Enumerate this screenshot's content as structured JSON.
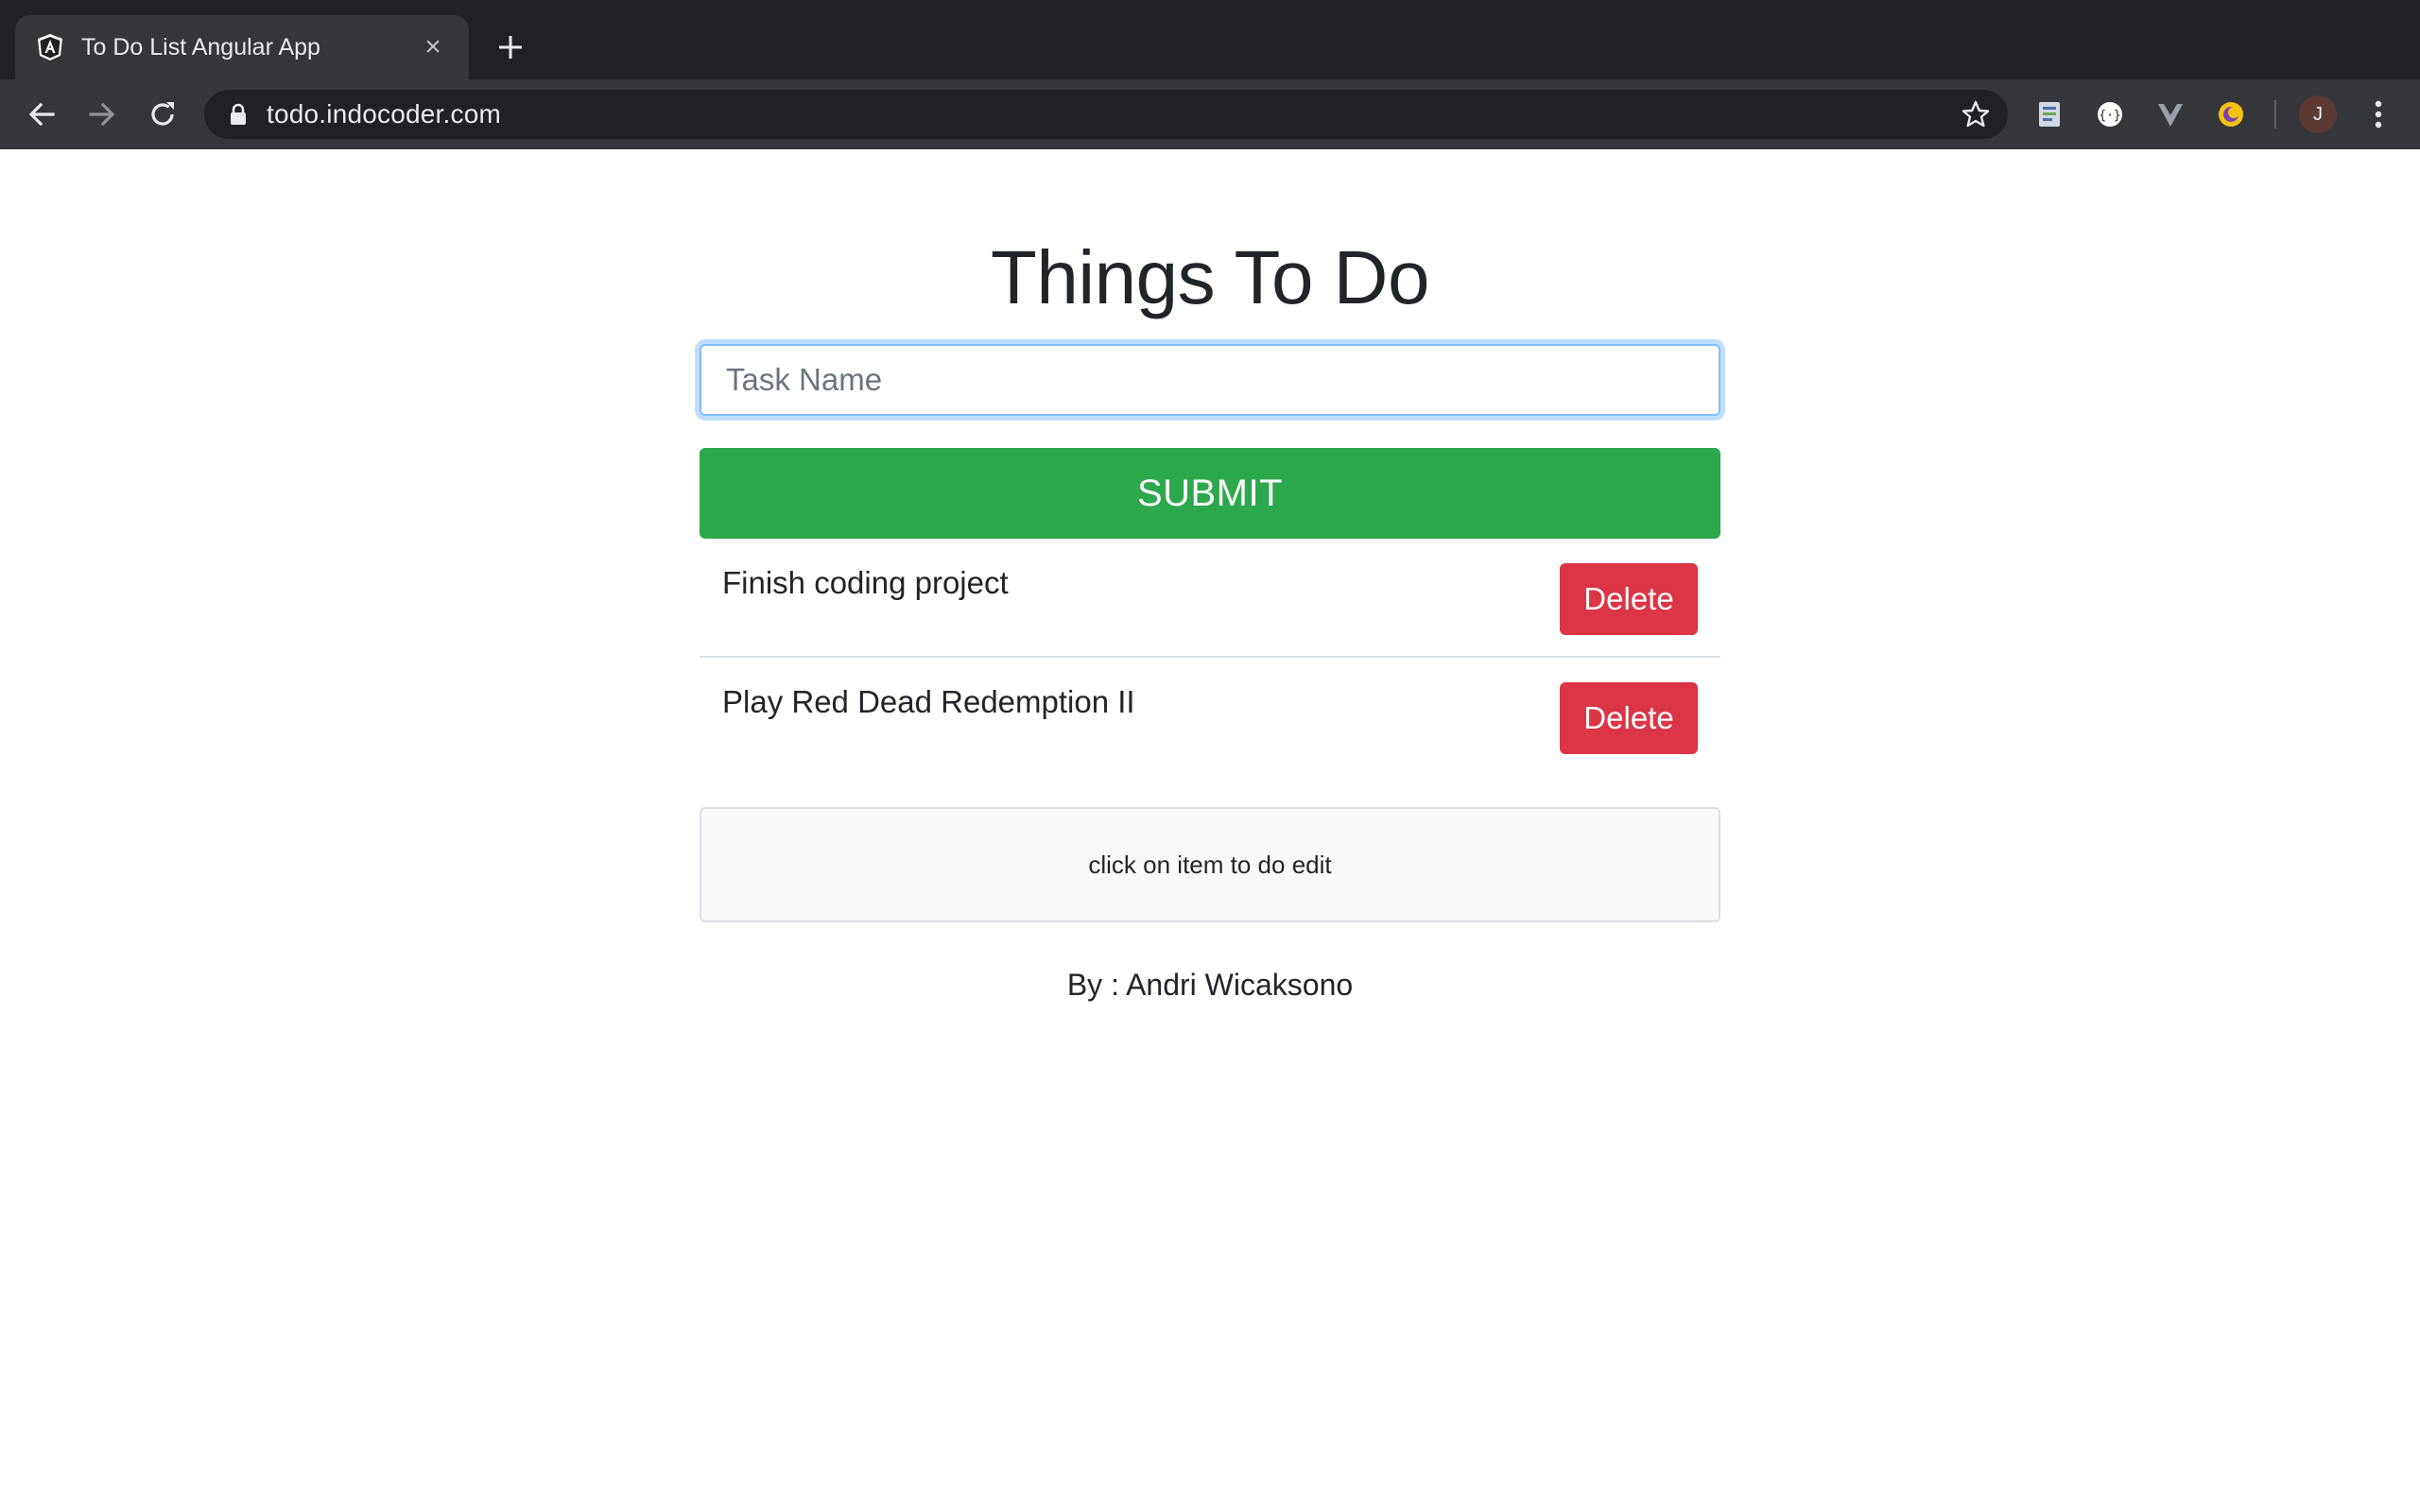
{
  "browser": {
    "tab": {
      "title": "To Do List Angular App",
      "close_glyph": "×",
      "favicon": "angular-icon"
    },
    "new_tab_glyph": "+",
    "address_bar": {
      "url": "todo.indocoder.com"
    },
    "profile_initial": "J",
    "icons": [
      "back-arrow-icon",
      "forward-arrow-icon",
      "reload-icon",
      "lock-icon",
      "bookmark-star-icon",
      "extension-icon",
      "kebab-menu-icon"
    ]
  },
  "app": {
    "title": "Things To Do",
    "task_input": {
      "placeholder": "Task Name",
      "value": ""
    },
    "submit_label": "SUBMIT",
    "todos": [
      {
        "text": "Finish coding project",
        "delete_label": "Delete"
      },
      {
        "text": "Play Red Dead Redemption II",
        "delete_label": "Delete"
      }
    ],
    "hint": "click on item to do edit",
    "author": "By : Andri Wicaksono"
  },
  "colors": {
    "chrome_dark": "#202124",
    "chrome_toolbar": "#35363a",
    "submit_green": "#2ea84c",
    "delete_red": "#dc3545",
    "focus_blue": "#80bdff",
    "text_dark": "#212529"
  }
}
